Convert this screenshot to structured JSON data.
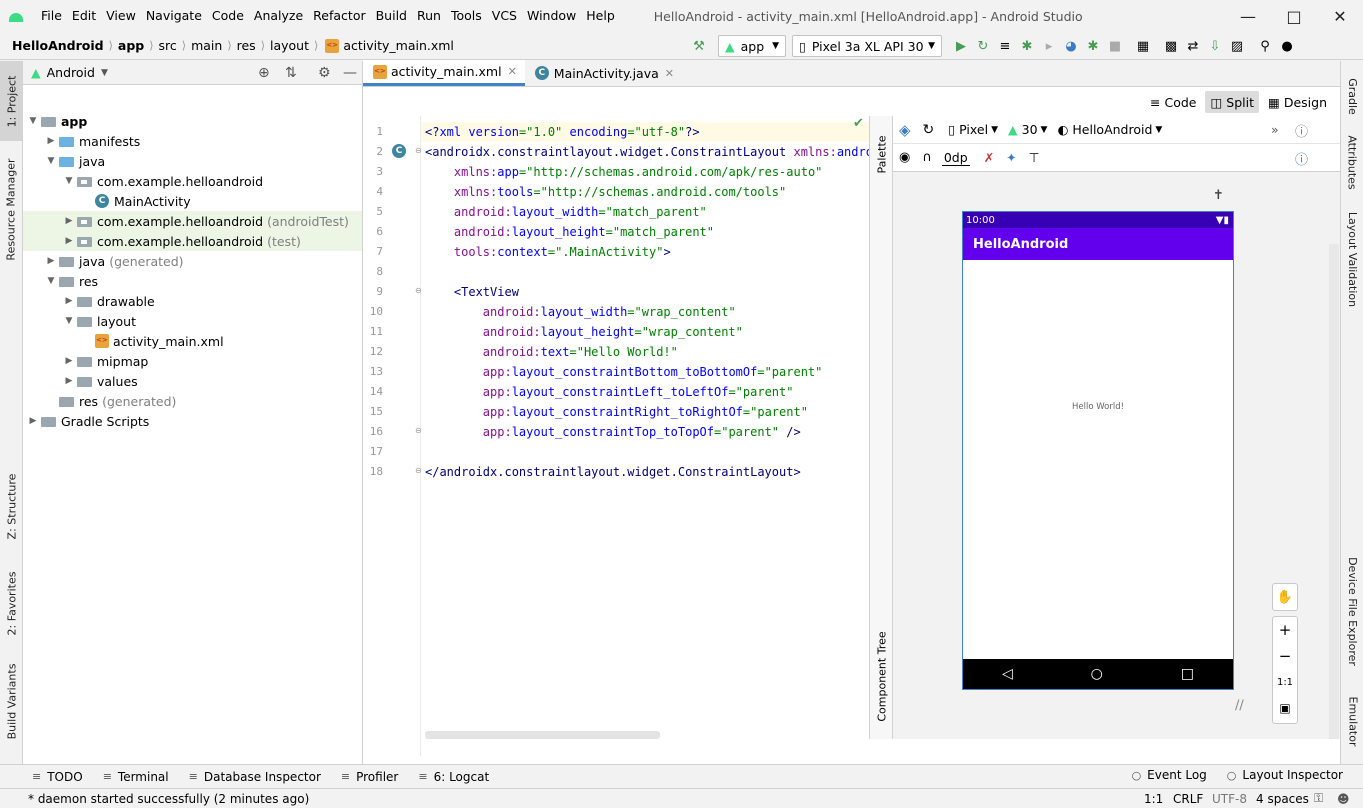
{
  "app_icon": "android-logo-icon",
  "menu": [
    "File",
    "Edit",
    "View",
    "Navigate",
    "Code",
    "Analyze",
    "Refactor",
    "Build",
    "Run",
    "Tools",
    "VCS",
    "Window",
    "Help"
  ],
  "window_title": "HelloAndroid - activity_main.xml [HelloAndroid.app] - Android Studio",
  "breadcrumbs": [
    "HelloAndroid",
    "app",
    "src",
    "main",
    "res",
    "layout",
    "activity_main.xml"
  ],
  "toolbar": {
    "run_config": "app",
    "device": "Pixel 3a XL API 30"
  },
  "left_tabs": [
    "1: Project",
    "Resource Manager",
    "Z: Structure",
    "2: Favorites",
    "Build Variants"
  ],
  "right_tabs": [
    "Gradle",
    "Attributes",
    "Layout Validation",
    "Device File Explorer",
    "Emulator"
  ],
  "project": {
    "view": "Android",
    "tree": [
      {
        "label": "app",
        "indent": 0,
        "icon": "module",
        "bold": true,
        "open": true
      },
      {
        "label": "manifests",
        "indent": 1,
        "icon": "folder-blue",
        "open": false
      },
      {
        "label": "java",
        "indent": 1,
        "icon": "folder-blue",
        "open": true
      },
      {
        "label": "com.example.helloandroid",
        "indent": 2,
        "icon": "package",
        "open": true
      },
      {
        "label": "MainActivity",
        "indent": 3,
        "icon": "class",
        "leaf": true
      },
      {
        "label": "com.example.helloandroid",
        "suffix": "(androidTest)",
        "indent": 2,
        "icon": "package",
        "open": false,
        "hl": true
      },
      {
        "label": "com.example.helloandroid",
        "suffix": "(test)",
        "indent": 2,
        "icon": "package",
        "open": false,
        "hl": true
      },
      {
        "label": "java",
        "suffix": "(generated)",
        "indent": 1,
        "icon": "folder",
        "open": false
      },
      {
        "label": "res",
        "indent": 1,
        "icon": "folder",
        "open": true
      },
      {
        "label": "drawable",
        "indent": 2,
        "icon": "folder",
        "open": false
      },
      {
        "label": "layout",
        "indent": 2,
        "icon": "folder",
        "open": true
      },
      {
        "label": "activity_main.xml",
        "indent": 3,
        "icon": "xml",
        "leaf": true
      },
      {
        "label": "mipmap",
        "indent": 2,
        "icon": "folder",
        "open": false
      },
      {
        "label": "values",
        "indent": 2,
        "icon": "folder",
        "open": false
      },
      {
        "label": "res",
        "suffix": "(generated)",
        "indent": 1,
        "icon": "folder",
        "leaf": true
      },
      {
        "label": "Gradle Scripts",
        "indent": 0,
        "icon": "gradle",
        "open": false
      }
    ]
  },
  "editor_tabs": [
    {
      "label": "activity_main.xml",
      "active": true
    },
    {
      "label": "MainActivity.java",
      "active": false
    }
  ],
  "modes": [
    "Code",
    "Split",
    "Design"
  ],
  "code_lines": [
    [
      [
        "t-tag",
        "<?"
      ],
      [
        "t-attr",
        "xml version"
      ],
      [
        "t-val",
        "=\"1.0\""
      ],
      [
        "t-attr",
        " encoding"
      ],
      [
        "t-val",
        "=\"utf-8\""
      ],
      [
        "t-tag",
        "?>"
      ]
    ],
    [
      [
        "t-tag",
        "<androidx.constraintlayout.widget.ConstraintLayout "
      ],
      [
        "t-ns",
        "xmlns:"
      ],
      [
        "t-attr",
        "android"
      ],
      [
        "t-val",
        "="
      ]
    ],
    [
      [
        "",
        "    "
      ],
      [
        "t-ns",
        "xmlns:"
      ],
      [
        "t-attr",
        "app"
      ],
      [
        "t-val",
        "=\"http://schemas.android.com/apk/res-auto\""
      ]
    ],
    [
      [
        "",
        "    "
      ],
      [
        "t-ns",
        "xmlns:"
      ],
      [
        "t-attr",
        "tools"
      ],
      [
        "t-val",
        "=\"http://schemas.android.com/tools\""
      ]
    ],
    [
      [
        "",
        "    "
      ],
      [
        "t-ns",
        "android:"
      ],
      [
        "t-attr",
        "layout_width"
      ],
      [
        "t-val",
        "=\"match_parent\""
      ]
    ],
    [
      [
        "",
        "    "
      ],
      [
        "t-ns",
        "android:"
      ],
      [
        "t-attr",
        "layout_height"
      ],
      [
        "t-val",
        "=\"match_parent\""
      ]
    ],
    [
      [
        "",
        "    "
      ],
      [
        "t-ns",
        "tools:"
      ],
      [
        "t-attr",
        "context"
      ],
      [
        "t-val",
        "=\".MainActivity\""
      ],
      [
        "t-tag",
        ">"
      ]
    ],
    [],
    [
      [
        "",
        "    "
      ],
      [
        "t-tag",
        "<TextView"
      ]
    ],
    [
      [
        "",
        "        "
      ],
      [
        "t-ns",
        "android:"
      ],
      [
        "t-attr",
        "layout_width"
      ],
      [
        "t-val",
        "=\"wrap_content\""
      ]
    ],
    [
      [
        "",
        "        "
      ],
      [
        "t-ns",
        "android:"
      ],
      [
        "t-attr",
        "layout_height"
      ],
      [
        "t-val",
        "=\"wrap_content\""
      ]
    ],
    [
      [
        "",
        "        "
      ],
      [
        "t-ns",
        "android:"
      ],
      [
        "t-attr",
        "text"
      ],
      [
        "t-val",
        "=\"Hello World!\""
      ]
    ],
    [
      [
        "",
        "        "
      ],
      [
        "t-ns",
        "app:"
      ],
      [
        "t-attr",
        "layout_constraintBottom_toBottomOf"
      ],
      [
        "t-val",
        "=\"parent\""
      ]
    ],
    [
      [
        "",
        "        "
      ],
      [
        "t-ns",
        "app:"
      ],
      [
        "t-attr",
        "layout_constraintLeft_toLeftOf"
      ],
      [
        "t-val",
        "=\"parent\""
      ]
    ],
    [
      [
        "",
        "        "
      ],
      [
        "t-ns",
        "app:"
      ],
      [
        "t-attr",
        "layout_constraintRight_toRightOf"
      ],
      [
        "t-val",
        "=\"parent\""
      ]
    ],
    [
      [
        "",
        "        "
      ],
      [
        "t-ns",
        "app:"
      ],
      [
        "t-attr",
        "layout_constraintTop_toTopOf"
      ],
      [
        "t-val",
        "=\"parent\""
      ],
      [
        "t-tag",
        " />"
      ]
    ],
    [],
    [
      [
        "t-tag",
        "</androidx.constraintlayout.widget.ConstraintLayout>"
      ]
    ]
  ],
  "design": {
    "palette_label": "Palette",
    "component_tree_label": "Component Tree",
    "device": "Pixel",
    "api": "30",
    "theme": "HelloAndroid",
    "margin": "0dp",
    "phone_time": "10:00",
    "phone_title": "HelloAndroid",
    "hello_text": "Hello World!",
    "zoom_fit": "1:1"
  },
  "bottom_tools": [
    {
      "label": "TODO",
      "icon": "list-icon"
    },
    {
      "label": "Terminal",
      "icon": "terminal-icon"
    },
    {
      "label": "Database Inspector",
      "icon": "database-icon"
    },
    {
      "label": "Profiler",
      "icon": "profiler-icon"
    },
    {
      "label": "6: Logcat",
      "icon": "logcat-icon"
    }
  ],
  "bottom_right_tools": [
    {
      "label": "Event Log",
      "icon": "event-log-icon"
    },
    {
      "label": "Layout Inspector",
      "icon": "layout-inspector-icon"
    }
  ],
  "status": {
    "message": "* daemon started successfully (2 minutes ago)",
    "position": "1:1",
    "line_sep": "CRLF",
    "encoding": "UTF-8",
    "indent": "4 spaces"
  },
  "colors": {
    "accent": "#4083c9",
    "android_green": "#3ddc84",
    "app_bar": "#6200ee",
    "status_bar": "#3700b3"
  }
}
